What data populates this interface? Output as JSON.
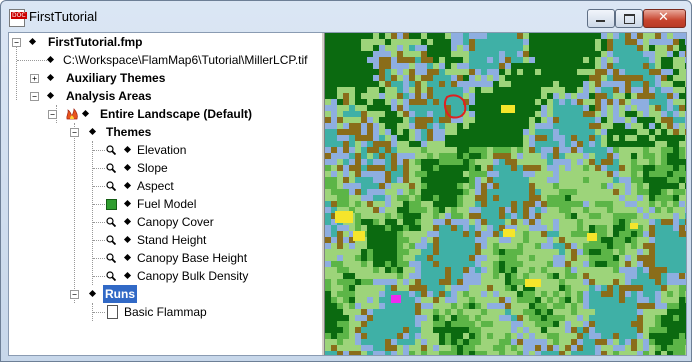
{
  "window": {
    "title": "FirstTutorial",
    "app_icon_badge": "DOC"
  },
  "tree": {
    "root": "FirstTutorial.fmp",
    "landscape_file": "C:\\Workspace\\FlamMap6\\Tutorial\\MillerLCP.tif",
    "auxiliary_themes": "Auxiliary Themes",
    "analysis_areas": "Analysis Areas",
    "entire_landscape": "Entire Landscape (Default)",
    "themes": "Themes",
    "theme_items": [
      "Elevation",
      "Slope",
      "Aspect",
      "Fuel Model",
      "Canopy Cover",
      "Stand Height",
      "Canopy Base Height",
      "Canopy Bulk Density"
    ],
    "runs": "Runs",
    "run_items": [
      "Basic Flammap"
    ]
  },
  "map": {
    "colors": {
      "dark_green": "#0b6a10",
      "light_green": "#9dd47a",
      "mid_green": "#5cb547",
      "blue": "#8eaee0",
      "brown": "#8a6d1a",
      "yellow": "#f5e52b",
      "magenta": "#ee2cf0",
      "teal": "#3fb0a6",
      "outline": "#e02020"
    }
  }
}
